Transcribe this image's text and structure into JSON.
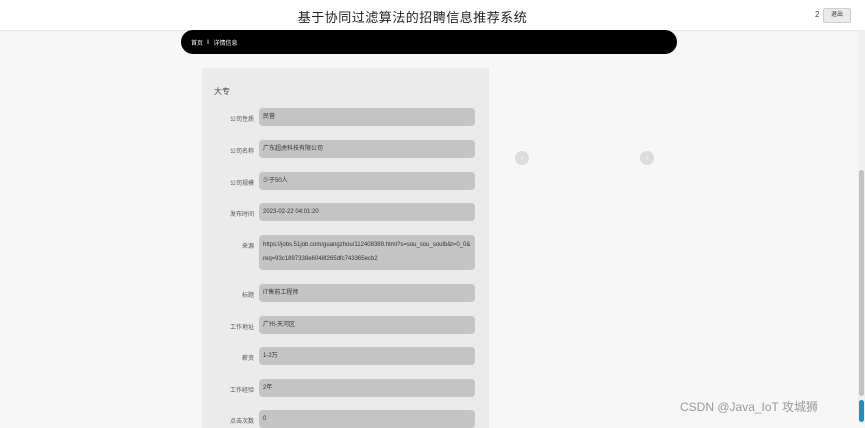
{
  "header": {
    "title": "基于协同过滤算法的招聘信息推荐系统",
    "user_count": "2",
    "logout_label": "退出"
  },
  "breadcrumb": {
    "home": "首页",
    "separator": "‖",
    "current": "详情信息"
  },
  "detail": {
    "heading": "大专",
    "fields": [
      {
        "label": "公司性质",
        "value": "民营"
      },
      {
        "label": "公司名称",
        "value": "广东超虎科技有限公司"
      },
      {
        "label": "公司规模",
        "value": "少于50人"
      },
      {
        "label": "发布时间",
        "value": "2023-02-22 04:01:20"
      },
      {
        "label": "来源",
        "value": "https://jobs.51job.com/guangzhou/112408389.html?s=sou_sou_soulb&t=0_0&req=93c1897338e6048f265dfc743365ecb2"
      },
      {
        "label": "标题",
        "value": "IT售前工程师"
      },
      {
        "label": "工作地址",
        "value": "广州-天河区"
      },
      {
        "label": "薪资",
        "value": "1-2万"
      },
      {
        "label": "工作经验",
        "value": "2年"
      },
      {
        "label": "点击次数",
        "value": "0"
      }
    ]
  },
  "carousel": {
    "prev_label": "‹",
    "next_label": "›"
  },
  "watermark": "CSDN @Java_IoT 攻城狮",
  "colors": {
    "breadcrumb_bg": "#000000",
    "field_bg": "#c4c4c4",
    "card_bg": "#ebebeb",
    "scroll_accent": "#1f8fbf"
  }
}
